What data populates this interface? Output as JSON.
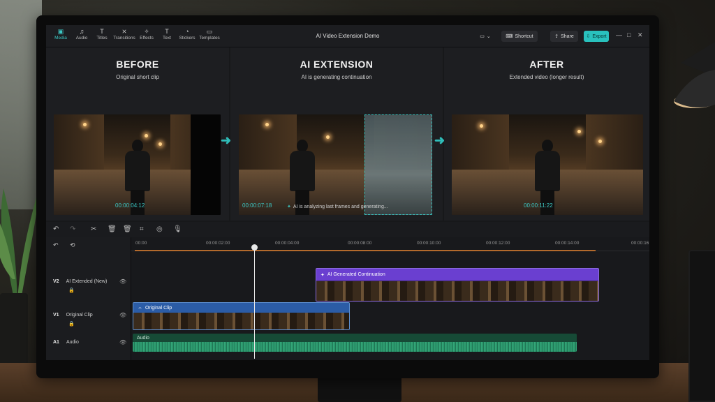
{
  "app": {
    "title": "AI Video Extension Demo",
    "accent_color": "#3cc7c3"
  },
  "toolbar": {
    "tools": [
      {
        "label": "Media",
        "icon": "media-icon",
        "active": true
      },
      {
        "label": "Audio",
        "icon": "music-note-icon"
      },
      {
        "label": "Titles",
        "icon": "titles-icon"
      },
      {
        "label": "Transitions",
        "icon": "transitions-icon"
      },
      {
        "label": "Effects",
        "icon": "effects-icon"
      },
      {
        "label": "Text",
        "icon": "text-icon"
      },
      {
        "label": "Stickers",
        "icon": "sticker-icon"
      },
      {
        "label": "Templates",
        "icon": "templates-icon"
      }
    ],
    "shortcut_label": "Shortcut",
    "share_label": "Share",
    "export_label": "Export"
  },
  "preview": {
    "before": {
      "heading": "BEFORE",
      "subtitle": "Original short clip",
      "timecode": "00:00:04:12"
    },
    "ai_extension": {
      "heading": "AI EXTENSION",
      "subtitle": "AI is generating continuation",
      "timecode": "00:00:07:18",
      "status": "AI is analyzing last frames and generating..."
    },
    "after": {
      "heading": "AFTER",
      "subtitle": "Extended video (longer result)",
      "timecode": "00:00:11:22"
    }
  },
  "timeline": {
    "ruler_ticks": [
      "00:00",
      "00:00:02:00",
      "00:00:04:00",
      "00:00:08:00",
      "00:00:10:00",
      "00:00:12:00",
      "00:00:14:00",
      "00:00:16"
    ],
    "tracks": [
      {
        "id": "V2",
        "name": "AI Extended (New)",
        "clip_label": "AI Generated Continuation",
        "clip_color": "#6a3fd0"
      },
      {
        "id": "V1",
        "name": "Original Clip",
        "clip_label": "Original Clip",
        "clip_color": "#2b5ca6"
      },
      {
        "id": "A1",
        "name": "Audio",
        "clip_label": "Audio",
        "clip_color": "#164a36"
      }
    ]
  }
}
